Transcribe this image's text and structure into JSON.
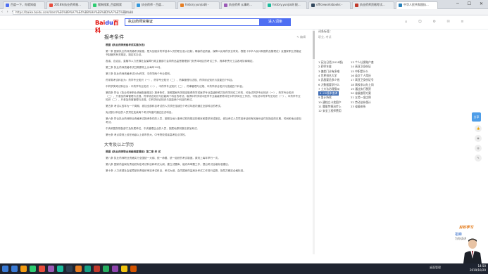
{
  "browser": {
    "tabs": [
      {
        "label": "百度一下，你就知道",
        "color": "#4e6ef2"
      },
      {
        "label": "2018年执业药师报...",
        "color": "#e74c3c"
      },
      {
        "label": "搜狗搜索_百度搜索",
        "color": "#2ecc71"
      },
      {
        "label": "执业药师 - 百度...",
        "color": "#3498db"
      },
      {
        "label": "history.yunjia网 -",
        "color": "#e67e22"
      },
      {
        "label": "执业药师 从事的...",
        "color": "#9b59b6"
      },
      {
        "label": "history.yunjia网 报...",
        "color": "#1abc9c"
      },
      {
        "label": "officeworksbooks -",
        "color": "#34495e"
      },
      {
        "label": "执业药师资格考试...",
        "color": "#c0392b"
      },
      {
        "label": "中华人民共和国执...",
        "color": "#2980b9"
      }
    ],
    "address": "https://baike.baidu.com/item/%E6%89%A7%E4%B8%9A%E8%8D%AF%E5%B8%88"
  },
  "header": {
    "logo_text": "Bai",
    "logo_text2": "du",
    "logo_text3": "百科",
    "search_value": "执业药师资格证",
    "search_button": "进入词条",
    "icons": [
      "home-icon",
      "user-icon",
      "settings-icon",
      "message-icon",
      "menu-icon"
    ]
  },
  "article": {
    "section_title": "报考条件",
    "edit_label": "✎ 编辑",
    "paragraphs": [
      {
        "text": "根据《执业药师资格考试实施办法》",
        "bold": true
      },
      {
        "text": "第一条 国家执业药师资格考试制度，是为加强对药学技术人员的职业准入控制，确保药品质量，保障人民用药安全有效，根据《中华人民共和国药品管理法》及国家职业资格证书制度的有关规定，制定本办法。",
        "bold": false
      },
      {
        "text": "各省、自治区、直辖市人力资源社会保障行政主管部门会同药品监督管理部门负责本地区的考试工作，具体职责分工由各地协商确定。",
        "bold": false
      },
      {
        "text": "第二条 执业药师资格考试日期原则上为每年10月。",
        "bold": false
      },
      {
        "text": "第三条 执业药师资格考试分为药学、中药学两个专业类别。",
        "bold": false
      },
      {
        "text": "药学类考试科目为：药学专业知识（一）、药学专业知识（二）、药事管理与法规、药学综合知识与技能四个科目。",
        "bold": false
      },
      {
        "text": "中药学类考试科目为：中药学专业知识（一）、中药学专业知识（二）、药事管理与法规、中药学综合知识与技能四个科目。",
        "bold": false
      },
      {
        "text": "第四条 符合《执业药师职业资格制度规定》报考条件，按照国家有关规定取得药学或医学专业高级职称并在药学岗位工作的，可免试药学专业知识（一）、药学专业知识（二），只参加药事管理与法规、药学综合知识与技能两个科目的考试；取得中药学或中医学专业高级职称并在中药学岗位工作的，可免试中药学专业知识（一）、中药学专业知识（二），只参加药事管理与法规、中药学综合知识与技能两个科目的考试。",
        "bold": false
      },
      {
        "text": "第五条 考试以四年为一个周期，参加全部科目考试的人员须在连续四个考试年度内通过全部科目的考试。",
        "bold": false
      },
      {
        "text": "免试部分科目的人员须在连续两个考试年度内通过应试科目。",
        "bold": false
      },
      {
        "text": "第六条 符合执业药师职业资格考试报考条件的人员，按照当地人事考试机构规定的程序和要求完成报名。参加考试人员凭准考证和有效身份证件在指定的日期、时间和地点参加考试。",
        "bold": false
      },
      {
        "text": "中央和国务院各部门及所属单位、中央管理企业的人员，按属地原则报名参加考试。",
        "bold": false
      },
      {
        "text": "第七条 考点原则上设在地级以上城市的大、中专院校或者高考定点学校。",
        "bold": false
      }
    ],
    "section_title2": "大专及以上学历",
    "paragraphs2": [
      {
        "text": "根据《执业药师职业资格制度规定》第二章 考 试",
        "bold": true
      },
      {
        "text": "第八条 执业药师职业资格实行全国统一大纲、统一命题、统一组织的考试制度。原则上每年举行一次。",
        "bold": false
      },
      {
        "text": "第九条 国家药监局负责组织拟定考试科目和考试大纲、建立试题库、组织命审题工作，提出考试合格标准建议。",
        "bold": false
      },
      {
        "text": "第十条 人力资源社会保障部负责组织审定考试科目、考试大纲，会同国家药监局对考试工作进行监督、指导并确定合格标准。",
        "bold": false
      }
    ]
  },
  "sidebar": {
    "title": "词条标签：",
    "subtitle": "职业, 考试",
    "list": [
      {
        "num": "1",
        "label": "宪法日话(2018版)",
        "selected": false
      },
      {
        "num": "2",
        "label": "药师年鉴",
        "selected": false
      },
      {
        "num": "3",
        "label": "偏差门诊有多难",
        "selected": false
      },
      {
        "num": "4",
        "label": "世界排名大学",
        "selected": false
      },
      {
        "num": "5",
        "label": "武昌要员多少钱",
        "selected": false
      },
      {
        "num": "6",
        "label": "大数据要学什么",
        "selected": false
      },
      {
        "num": "7",
        "label": "土方法治理蚕瓜",
        "selected": false
      },
      {
        "num": "8",
        "label": "iOS版本查询",
        "selected": true
      },
      {
        "num": "9",
        "label": "里计持续",
        "selected": false
      },
      {
        "num": "10",
        "label": "建档立卡贫困户",
        "selected": false
      },
      {
        "num": "11",
        "label": "腰肌劳损治疗上",
        "selected": false
      },
      {
        "num": "12",
        "label": "安全工程师费用",
        "selected": false
      },
      {
        "num": "13",
        "label": "个人社保账户查",
        "selected": false
      },
      {
        "num": "14",
        "label": "高亚卫身份证",
        "selected": false
      },
      {
        "num": "15",
        "label": "中职是什么",
        "selected": false
      },
      {
        "num": "16",
        "label": "英文个人简历",
        "selected": false
      },
      {
        "num": "17",
        "label": "高亚卫身份证号",
        "selected": false
      },
      {
        "num": "18",
        "label": "高校非公办上岗",
        "selected": false
      },
      {
        "num": "19",
        "label": "通过执行税资",
        "selected": false
      },
      {
        "num": "20",
        "label": "省级推荐方案",
        "selected": false
      },
      {
        "num": "21",
        "label": "五险一金比例",
        "selected": false
      },
      {
        "num": "22",
        "label": "劳动法补偿计",
        "selected": false
      },
      {
        "num": "23",
        "label": "省级体系",
        "selected": false
      }
    ]
  },
  "rightrail": {
    "share_label": "分享",
    "icons": [
      "thumb-up-icon",
      "weibo-icon",
      "wechat-icon",
      "comment-icon"
    ]
  },
  "video": {
    "logo": "好好学习",
    "name": "祖峰",
    "sub": "为你读讲"
  },
  "taskbar": {
    "app_colors": [
      "#3a7bd5",
      "#f39c12",
      "#2ecc71",
      "#e74c3c",
      "#9b59b6",
      "#1abc9c",
      "#2c3e50",
      "#e67e22",
      "#16a085",
      "#c0392b",
      "#27ae60",
      "#8e44ad",
      "#f1c40f",
      "#d35400"
    ],
    "tray_text": "桌面管理",
    "time": "14:50",
    "date": "2019/10/20"
  }
}
